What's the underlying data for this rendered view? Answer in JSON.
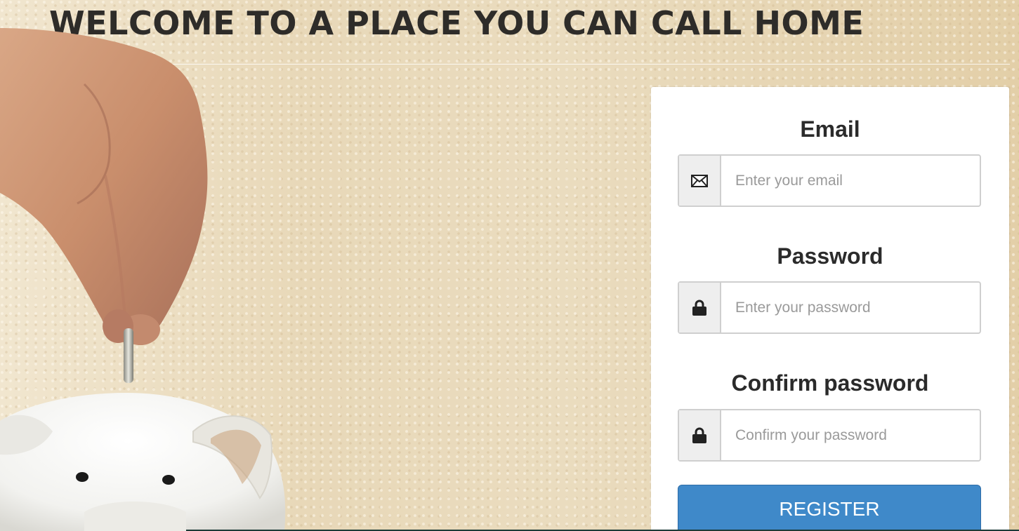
{
  "page": {
    "title": "WELCOME TO A PLACE YOU CAN CALL HOME"
  },
  "colors": {
    "background": "#e9dcc2",
    "panel": "#ffffff",
    "button": "#3f89c9",
    "title_text": "#2e2c29"
  },
  "form": {
    "email": {
      "label": "Email",
      "placeholder": "Enter your email",
      "icon": "envelope-icon"
    },
    "password": {
      "label": "Password",
      "placeholder": "Enter your password",
      "icon": "lock-icon"
    },
    "confirm_password": {
      "label": "Confirm password",
      "placeholder": "Confirm your password",
      "icon": "lock-icon"
    },
    "submit_label": "REGISTER"
  }
}
